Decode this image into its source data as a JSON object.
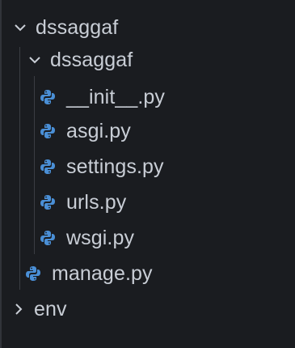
{
  "explorer": {
    "root_folder": {
      "label": "dssaggaf",
      "icon": "chevron-down-icon"
    },
    "sub_folder": {
      "label": "dssaggaf",
      "icon": "chevron-down-icon"
    },
    "files": [
      {
        "label": "__init__.py",
        "icon": "python-icon"
      },
      {
        "label": "asgi.py",
        "icon": "python-icon"
      },
      {
        "label": "settings.py",
        "icon": "python-icon"
      },
      {
        "label": "urls.py",
        "icon": "python-icon"
      },
      {
        "label": "wsgi.py",
        "icon": "python-icon"
      }
    ],
    "manage_file": {
      "label": "manage.py",
      "icon": "python-icon"
    },
    "env_folder": {
      "label": "env",
      "icon": "chevron-right-icon"
    }
  },
  "colors": {
    "background": "#1a1c20",
    "text": "#c9ced6",
    "python_blue": "#4a8fd6",
    "indent_guide": "#3a3d43"
  }
}
